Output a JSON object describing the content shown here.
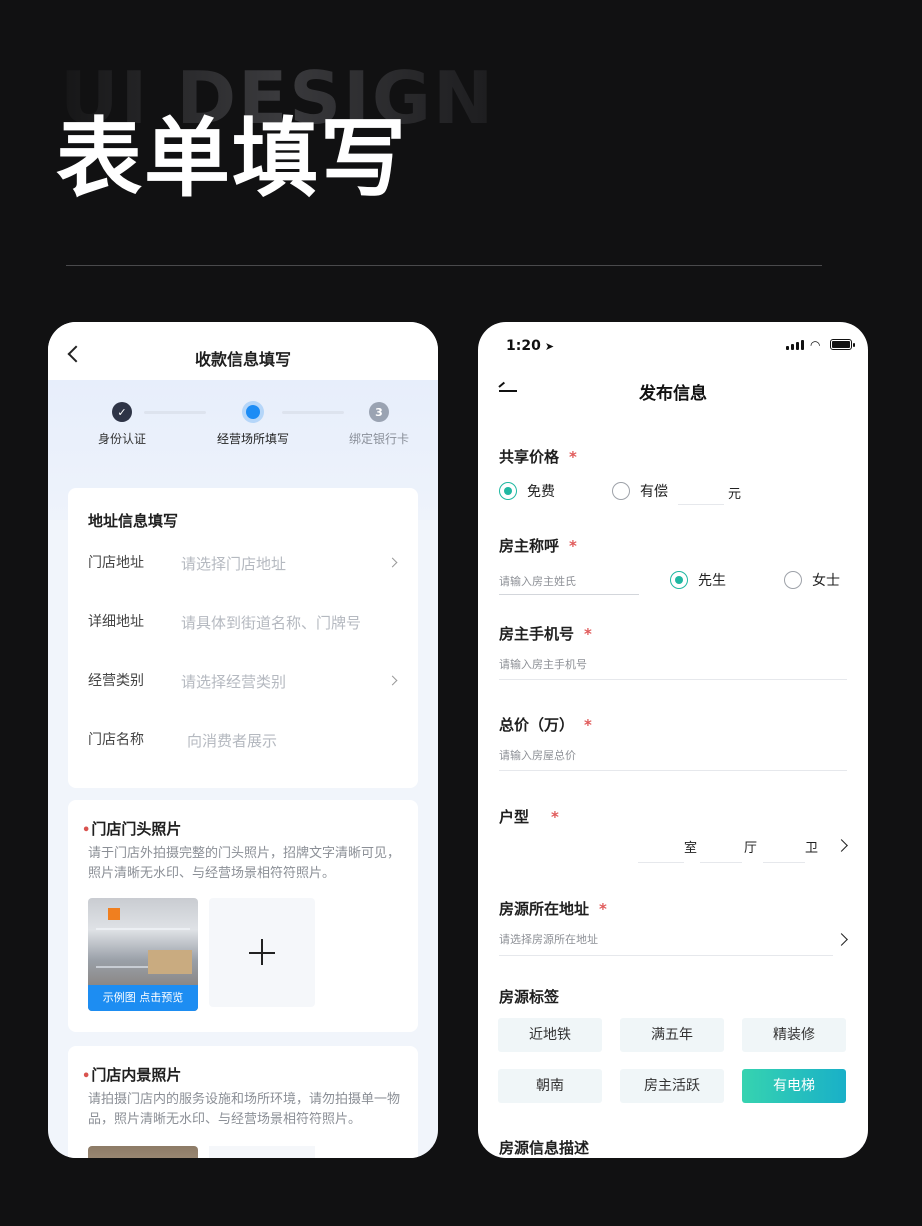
{
  "hero": {
    "watermark": "UI DESIGN",
    "title": "表单填写"
  },
  "left_phone": {
    "nav_title": "收款信息填写",
    "steps": [
      {
        "label": "身份认证",
        "state": "done"
      },
      {
        "label": "经营场所填写",
        "state": "active"
      },
      {
        "label": "绑定银行卡",
        "state": "pending",
        "number": "3"
      }
    ],
    "address_card": {
      "title": "地址信息填写",
      "rows": [
        {
          "label": "门店地址",
          "placeholder": "请选择门店地址",
          "has_arrow": true
        },
        {
          "label": "详细地址",
          "placeholder": "请具体到街道名称、门牌号",
          "has_arrow": false
        },
        {
          "label": "经营类别",
          "placeholder": "请选择经营类别",
          "has_arrow": true
        },
        {
          "label": "门店名称",
          "placeholder": "向消费者展示",
          "has_arrow": false
        }
      ]
    },
    "front_photo": {
      "required_mark": "•",
      "title": "门店门头照片",
      "desc": "请于门店外拍摄完整的门头照片，招牌文字清晰可见，照片清晰无水印、与经营场景相符符照片。",
      "sample_badge": "示例图 点击预览"
    },
    "inside_photo": {
      "required_mark": "•",
      "title": "门店内景照片",
      "desc": "请拍摄门店内的服务设施和场所环境，请勿拍摄单一物品，照片清晰无水印、与经营场景相符符照片。"
    }
  },
  "right_phone": {
    "status_time": "1:20",
    "nav_title": "发布信息",
    "required_star": "*",
    "share_price": {
      "label": "共享价格",
      "options": [
        {
          "label": "免费",
          "selected": true
        },
        {
          "label": "有偿",
          "selected": false
        }
      ],
      "unit": "元"
    },
    "owner_title": {
      "label": "房主称呼",
      "placeholder": "请输入房主姓氏",
      "options": [
        {
          "label": "先生",
          "selected": true
        },
        {
          "label": "女士",
          "selected": false
        }
      ]
    },
    "owner_phone": {
      "label": "房主手机号",
      "placeholder": "请输入房主手机号"
    },
    "total_price": {
      "label": "总价（万）",
      "placeholder": "请输入房屋总价"
    },
    "layout": {
      "label": "户型",
      "units": [
        "室",
        "厅",
        "卫"
      ]
    },
    "address": {
      "label": "房源所在地址",
      "placeholder": "请选择房源所在地址"
    },
    "tags": {
      "label": "房源标签",
      "items": [
        {
          "label": "近地铁",
          "selected": false
        },
        {
          "label": "满五年",
          "selected": false
        },
        {
          "label": "精装修",
          "selected": false
        },
        {
          "label": "朝南",
          "selected": false
        },
        {
          "label": "房主活跃",
          "selected": false
        },
        {
          "label": "有电梯",
          "selected": true
        }
      ]
    },
    "description": {
      "label": "房源信息描述"
    }
  },
  "colors": {
    "background": "#111112",
    "accent_blue": "#1c8cf5",
    "accent_teal": "#20b8a2",
    "required_red": "#e05a5a"
  }
}
